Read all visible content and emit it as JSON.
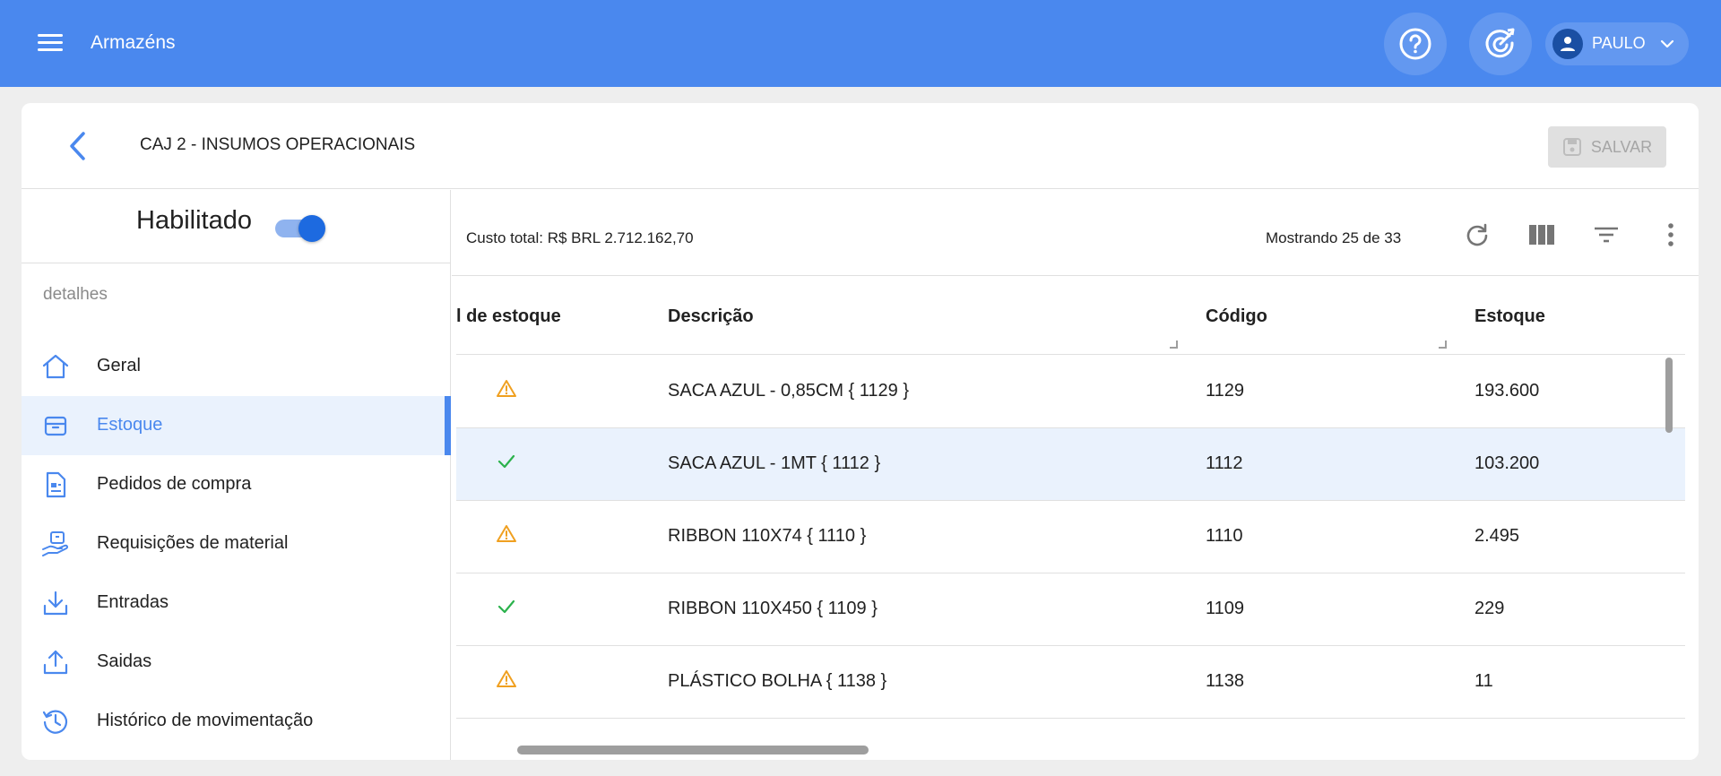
{
  "appbar": {
    "title": "Armazéns",
    "help_icon": "help-circle-icon",
    "goals_icon": "target-arrow-icon",
    "user_name": "PAULO"
  },
  "header": {
    "title": "CAJ 2 - INSUMOS OPERACIONAIS",
    "save_label": "SALVAR"
  },
  "sidebar": {
    "enabled_label": "Habilitado",
    "enabled": true,
    "section_label": "detalhes",
    "items": [
      {
        "label": "Geral",
        "icon": "home-icon"
      },
      {
        "label": "Estoque",
        "icon": "box-icon",
        "active": true
      },
      {
        "label": "Pedidos de compra",
        "icon": "document-icon"
      },
      {
        "label": "Requisições de material",
        "icon": "hand-box-icon"
      },
      {
        "label": "Entradas",
        "icon": "download-icon"
      },
      {
        "label": "Saidas",
        "icon": "upload-icon"
      },
      {
        "label": "Histórico de movimentação",
        "icon": "history-icon"
      }
    ]
  },
  "toolbar": {
    "total_cost": "Custo total: R$ BRL 2.712.162,70",
    "showing": "Mostrando 25 de 33"
  },
  "table": {
    "columns": [
      "l de estoque",
      "Descrição",
      "Código",
      "Estoque"
    ],
    "rows": [
      {
        "status": "warning",
        "description": "SACA AZUL - 0,85CM { 1129 }",
        "code": "1129",
        "stock": "193.600"
      },
      {
        "status": "ok",
        "description": "SACA AZUL - 1MT { 1112 }",
        "code": "1112",
        "stock": "103.200"
      },
      {
        "status": "warning",
        "description": "RIBBON 110X74 { 1110 }",
        "code": "1110",
        "stock": "2.495"
      },
      {
        "status": "ok",
        "description": "RIBBON 110X450 { 1109 }",
        "code": "1109",
        "stock": "229"
      },
      {
        "status": "warning",
        "description": "PLÁSTICO BOLHA { 1138 }",
        "code": "1138",
        "stock": "11"
      }
    ]
  },
  "colors": {
    "brand": "#4a88ee",
    "warning": "#f0a020",
    "ok": "#2bb24c"
  }
}
